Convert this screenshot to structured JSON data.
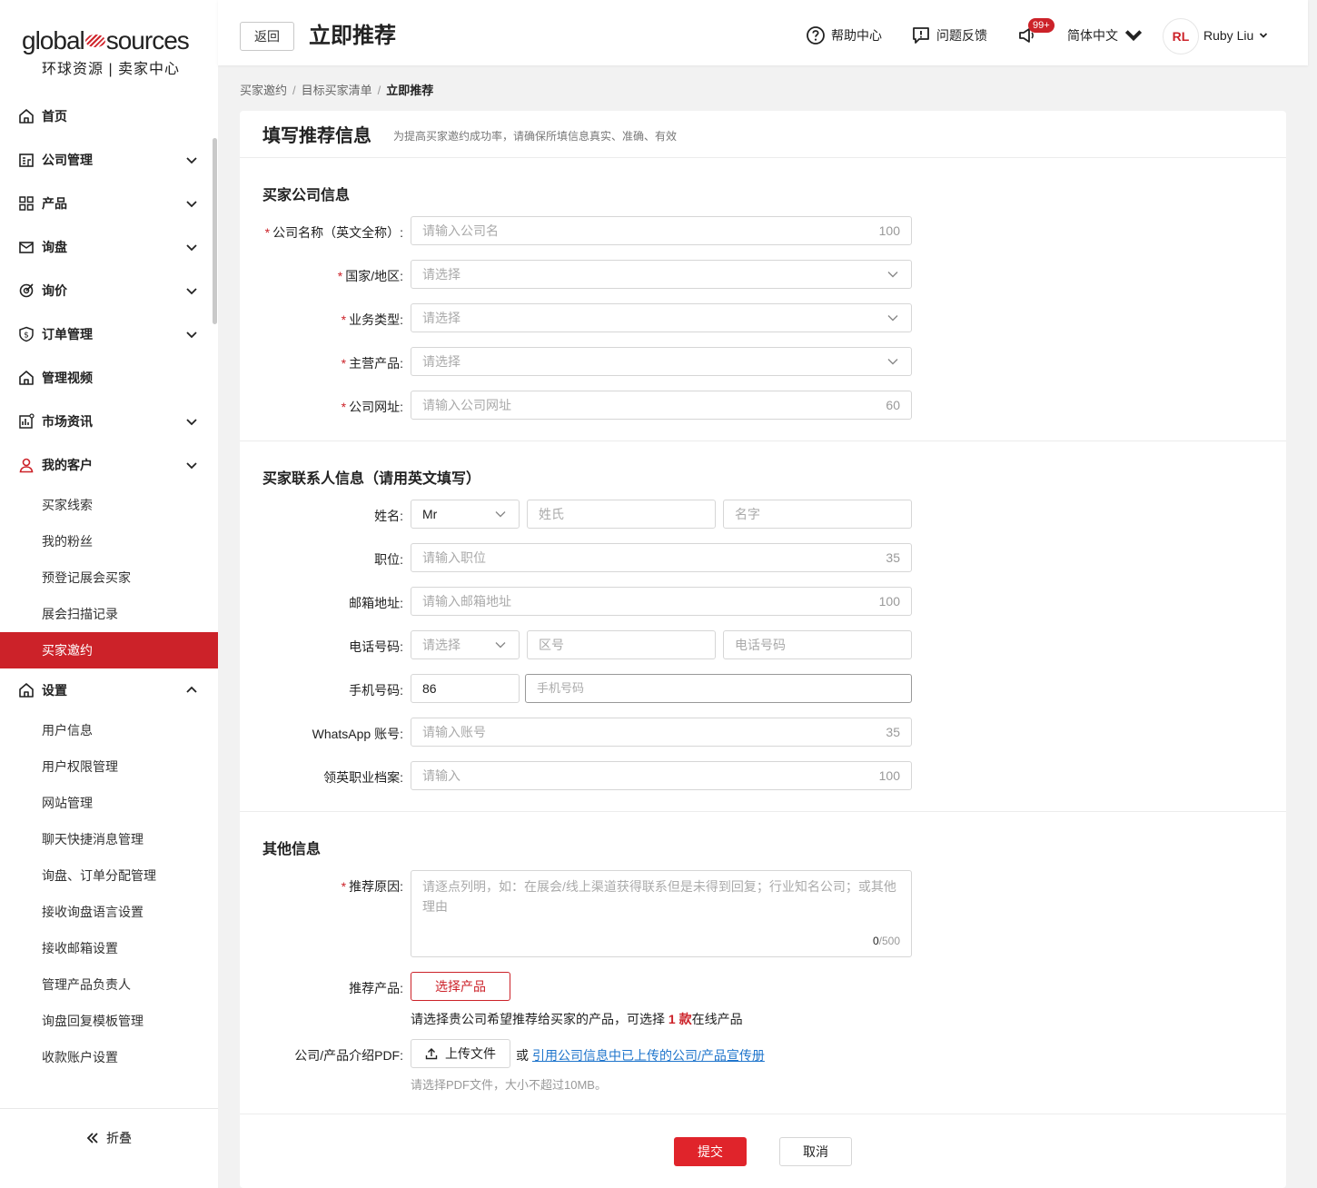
{
  "brand": {
    "logo_left": "global",
    "logo_right": "sources",
    "subtitle": "环球资源 | 卖家中心",
    "accent_color": "#cc2229"
  },
  "sidebar": {
    "items": [
      {
        "label": "首页",
        "icon": "home-icon"
      },
      {
        "label": "公司管理",
        "icon": "company-icon"
      },
      {
        "label": "产品",
        "icon": "grid-icon"
      },
      {
        "label": "询盘",
        "icon": "mail-icon"
      },
      {
        "label": "询价",
        "icon": "target-icon"
      },
      {
        "label": "订单管理",
        "icon": "shield-dollar-icon"
      },
      {
        "label": "管理视频",
        "icon": "home-icon"
      },
      {
        "label": "市场资讯",
        "icon": "chart-icon"
      },
      {
        "label": "我的客户",
        "icon": "user-icon"
      }
    ],
    "customer_sub": [
      "买家线索",
      "我的粉丝",
      "预登记展会买家",
      "展会扫描记录",
      "买家邀约"
    ],
    "active_sub": "买家邀约",
    "settings_label": "设置",
    "settings_sub": [
      "用户信息",
      "用户权限管理",
      "网站管理",
      "聊天快捷消息管理",
      "询盘、订单分配管理",
      "接收询盘语言设置",
      "接收邮箱设置",
      "管理产品负责人",
      "询盘回复模板管理",
      "收款账户设置"
    ],
    "collapse_label": "折叠"
  },
  "header": {
    "back_label": "返回",
    "title": "立即推荐",
    "help_label": "帮助中心",
    "feedback_label": "问题反馈",
    "notice_badge": "99+",
    "language": "简体中文",
    "avatar_initials": "RL",
    "username": "Ruby Liu"
  },
  "breadcrumb": [
    "买家邀约",
    "目标买家清单",
    "立即推荐"
  ],
  "form": {
    "title": "填写推荐信息",
    "hint": "为提高买家邀约成功率，请确保所填信息真实、准确、有效",
    "company_section": "买家公司信息",
    "company_name": {
      "label": "公司名称（英文全称）:",
      "placeholder": "请输入公司名",
      "max": "100"
    },
    "country": {
      "label": "国家/地区:",
      "placeholder": "请选择"
    },
    "business_type": {
      "label": "业务类型:",
      "placeholder": "请选择"
    },
    "main_products": {
      "label": "主营产品:",
      "placeholder": "请选择"
    },
    "website": {
      "label": "公司网址:",
      "placeholder": "请输入公司网址",
      "max": "60"
    },
    "contact_section": "买家联系人信息（请用英文填写）",
    "name": {
      "label": "姓名:",
      "title_value": "Mr",
      "last_placeholder": "姓氏",
      "first_placeholder": "名字"
    },
    "position": {
      "label": "职位:",
      "placeholder": "请输入职位",
      "max": "35"
    },
    "email": {
      "label": "邮箱地址:",
      "placeholder": "请输入邮箱地址",
      "max": "100"
    },
    "phone": {
      "label": "电话号码:",
      "country_placeholder": "请选择",
      "area_placeholder": "区号",
      "number_placeholder": "电话号码"
    },
    "mobile": {
      "label": "手机号码:",
      "code_value": "86",
      "placeholder": "手机号码"
    },
    "whatsapp": {
      "label": "WhatsApp 账号:",
      "placeholder": "请输入账号",
      "max": "35"
    },
    "linkedin": {
      "label": "领英职业档案:",
      "placeholder": "请输入",
      "max": "100"
    },
    "other_section": "其他信息",
    "reason": {
      "label": "推荐原因:",
      "placeholder": "请逐点列明，如：在展会/线上渠道获得联系但是未得到回复；行业知名公司；或其他理由",
      "count": "0",
      "max": "/500"
    },
    "products": {
      "label": "推荐产品:",
      "button": "选择产品",
      "note_before": "请选择贵公司希望推荐给买家的产品，可选择 ",
      "note_count": "1 款",
      "note_after": "在线产品"
    },
    "pdf": {
      "label": "公司/产品介绍PDF:",
      "upload": "上传文件",
      "or": "或",
      "link": "引用公司信息中已上传的公司/产品宣传册",
      "hint": "请选择PDF文件，大小不超过10MB。"
    },
    "submit": "提交",
    "cancel": "取消"
  }
}
